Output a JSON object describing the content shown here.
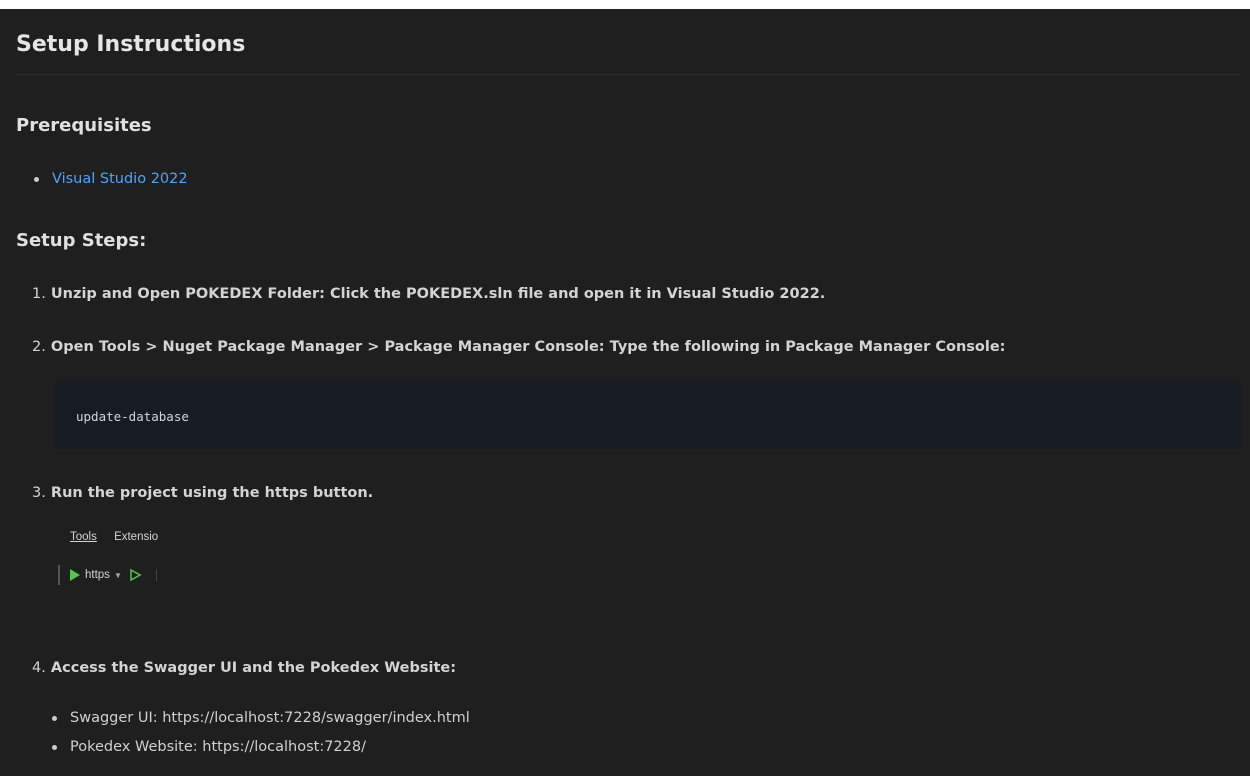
{
  "doc": {
    "title": "Setup Instructions",
    "prerequisites_heading": "Prerequisites",
    "prerequisites": [
      {
        "label": "Visual Studio 2022"
      }
    ],
    "steps_heading": "Setup Steps:",
    "steps": [
      {
        "num": "1.",
        "text": "Unzip and Open POKEDEX Folder: Click the POKEDEX.sln file and open it in Visual Studio 2022."
      },
      {
        "num": "2.",
        "text": "Open Tools > Nuget Package Manager > Package Manager Console: Type the following in Package Manager Console:"
      },
      {
        "num": "3.",
        "text": "Run the project using the https button."
      },
      {
        "num": "4.",
        "text": "Access the Swagger UI and the Pokedex Website:"
      }
    ],
    "code": "update-database",
    "vs_toolbar": {
      "menu_tools": "Tools",
      "menu_extensions": "Extensio",
      "run_label": "https"
    },
    "access_links": [
      {
        "text": "Swagger UI: https://localhost:7228/swagger/index.html"
      },
      {
        "text": "Pokedex Website: https://localhost:7228/"
      }
    ]
  },
  "colors": {
    "background": "#1f1f1f",
    "link": "#4da3ff",
    "code_bg": "#171b24",
    "run_green": "#4ec94e"
  }
}
